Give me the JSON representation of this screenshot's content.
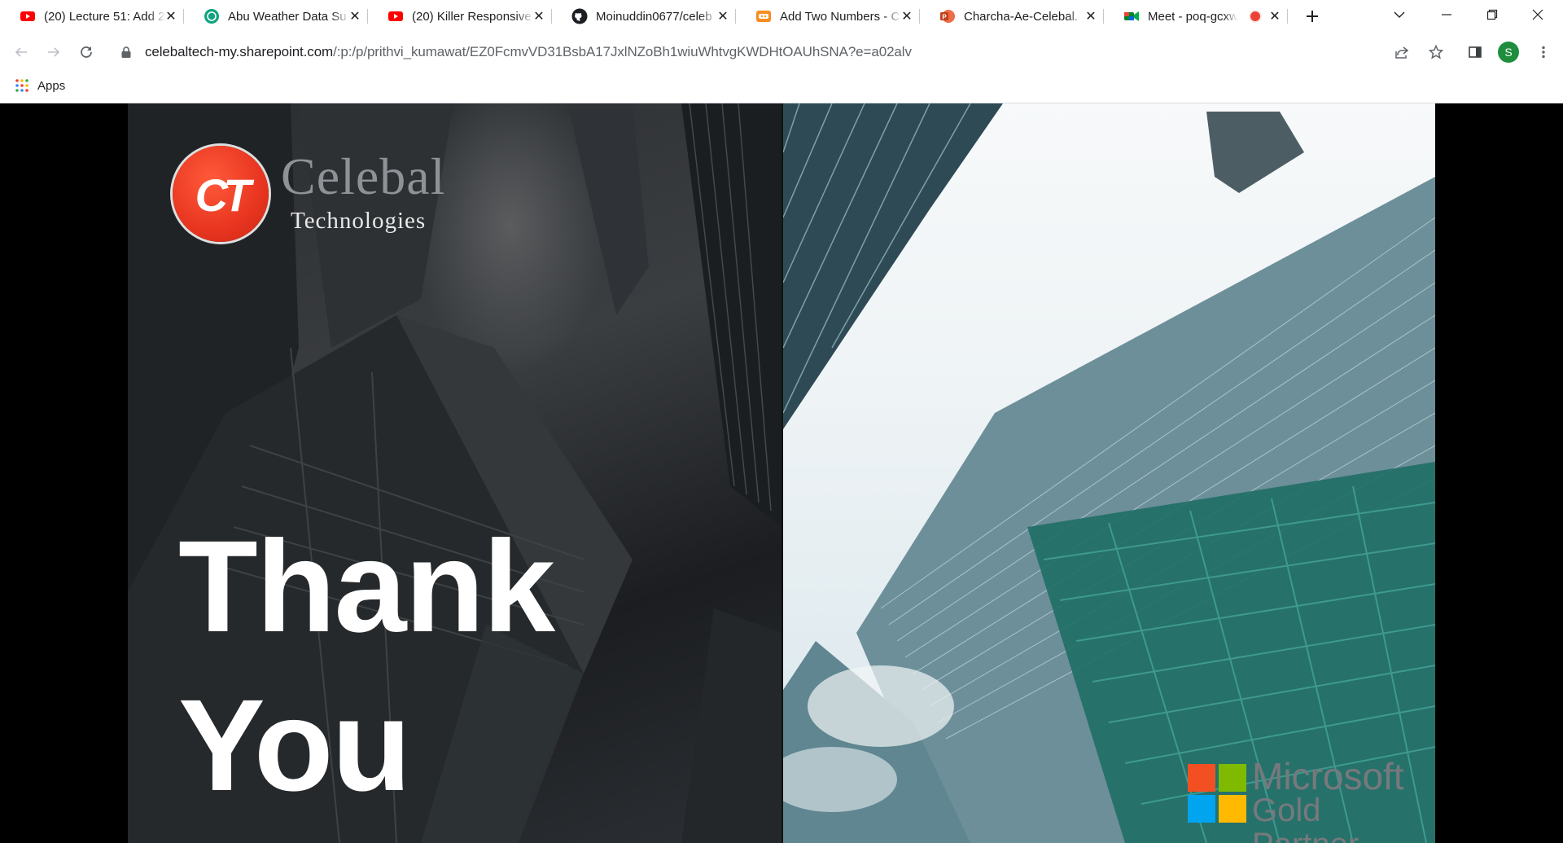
{
  "browser": {
    "tabs": [
      {
        "title": "(20) Lecture 51: Add 2",
        "icon": "youtube-icon"
      },
      {
        "title": "Abu Weather Data Su",
        "icon": "chatgpt-icon"
      },
      {
        "title": "(20) Killer Responsive",
        "icon": "youtube-icon"
      },
      {
        "title": "Moinuddin0677/celeb",
        "icon": "github-icon"
      },
      {
        "title": "Add Two Numbers - C",
        "icon": "codingninjas-icon"
      },
      {
        "title": "Charcha-Ae-Celebal.",
        "icon": "powerpoint-icon"
      },
      {
        "title": "Meet - poq-gcxw",
        "icon": "google-meet-icon",
        "recording": true
      }
    ],
    "address": {
      "domain": "celebaltech-my.sharepoint.com",
      "path": "/:p:/p/prithvi_kumawat/EZ0FcmvVD31BsbA17JxlNZoBh1wiuWhtvgKWDHtOAUhSNA?e=a02alv"
    },
    "profile_initial": "S",
    "bookmarks": {
      "apps_label": "Apps"
    }
  },
  "slide": {
    "heading_line1": "Thank",
    "heading_line2": "You",
    "brand": {
      "mark": "CT",
      "name": "Celebal",
      "subname": "Technologies"
    },
    "partner": {
      "line1": "Microsoft",
      "line2": "Gold Partner"
    },
    "colors": {
      "brand_red": "#e83520",
      "ms_red": "#f25022",
      "ms_green": "#7fba00",
      "ms_blue": "#00a4ef",
      "ms_yellow": "#ffb900"
    }
  }
}
